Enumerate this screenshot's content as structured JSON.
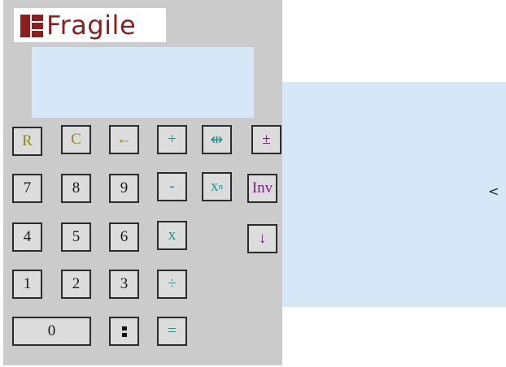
{
  "app": {
    "logo_text": "Fragile"
  },
  "keys": {
    "reset": "R",
    "clear": "C",
    "backspace": "←",
    "plus": "+",
    "swap": "⇹",
    "plus_minus": "±",
    "seven": "7",
    "eight": "8",
    "nine": "9",
    "minus": "-",
    "power_base": "x",
    "power_exp": "n",
    "inv": "Inv",
    "four": "4",
    "five": "5",
    "six": "6",
    "multiply": "x",
    "down": "↓",
    "one": "1",
    "two": "2",
    "three": "3",
    "divide": "÷",
    "zero": "0",
    "equals": "="
  },
  "side_panel": {
    "toggle_label": "<"
  },
  "colors": {
    "body": "#cbcbcb",
    "display": "#d6e8f8",
    "logo": "#8b1f1f",
    "olive_keys": "#8a8a1a",
    "teal_keys": "#2a8e8e",
    "purple_keys": "#7a1f8c"
  }
}
